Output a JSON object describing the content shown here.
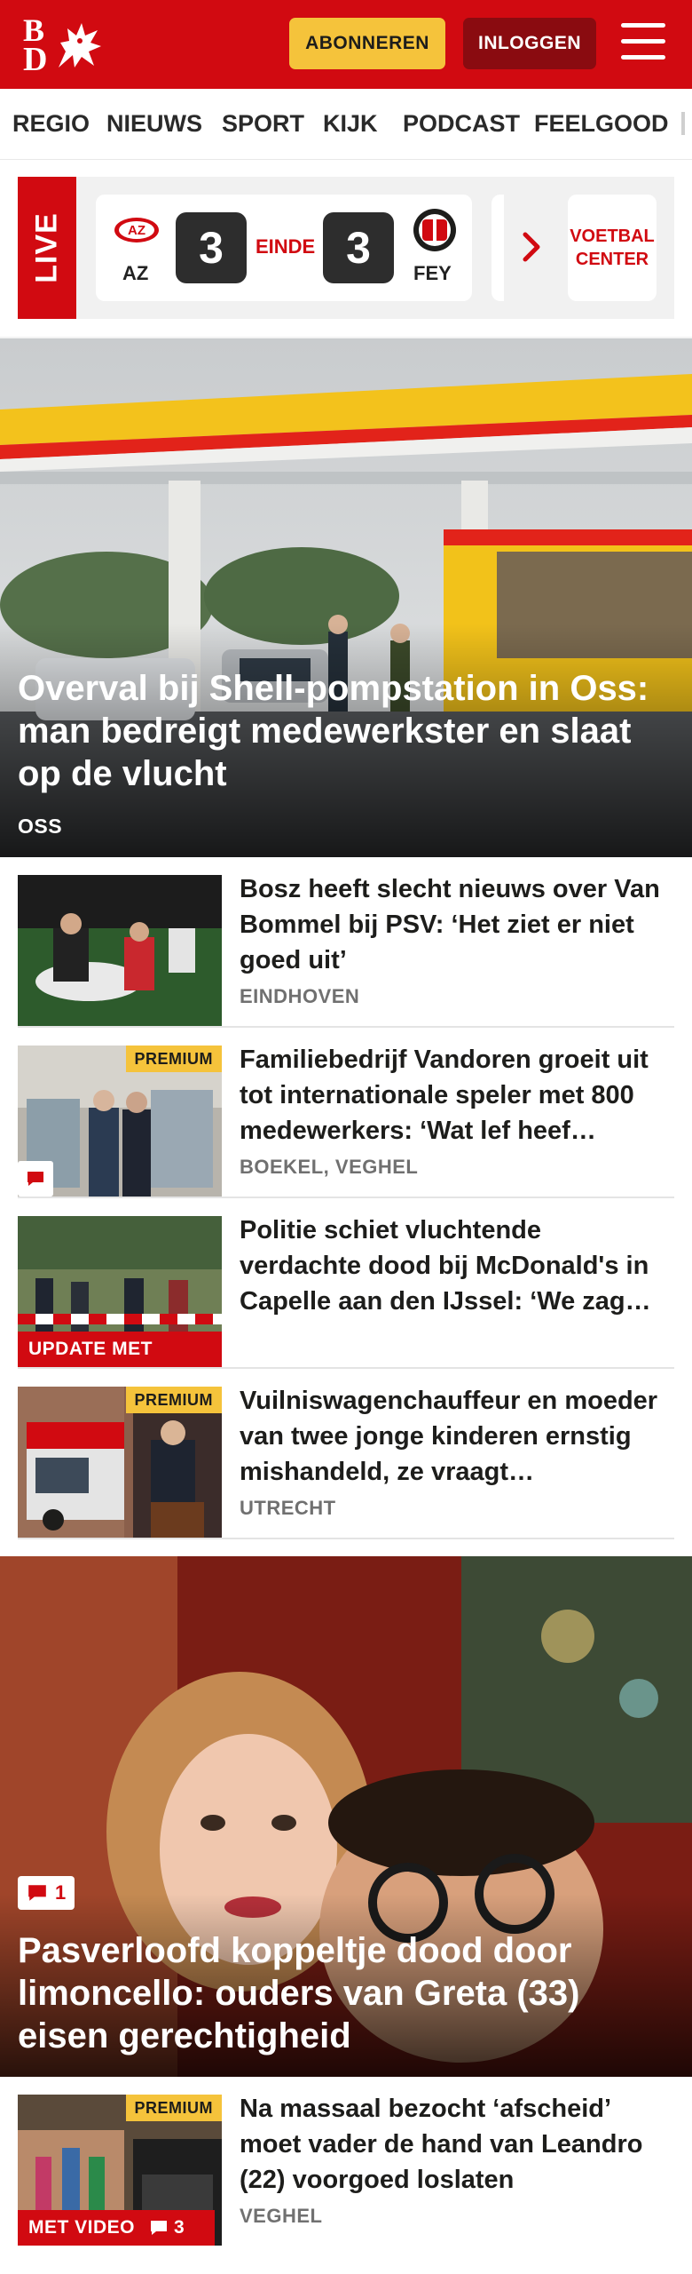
{
  "header": {
    "logo_text_b": "B",
    "logo_text_d": "D",
    "subscribe_label": "ABONNEREN",
    "login_label": "INLOGGEN",
    "menu_icon": "hamburger-icon",
    "brand_color": "#d10a11"
  },
  "nav": {
    "items": [
      {
        "label": "REGIO"
      },
      {
        "label": "NIEUWS"
      },
      {
        "label": "SPORT"
      },
      {
        "label": "KIJK"
      },
      {
        "label": "PODCAST"
      },
      {
        "label": "FEELGOOD"
      }
    ]
  },
  "live": {
    "badge": "LIVE",
    "match": {
      "home_team": "AZ",
      "away_team": "FEY",
      "home_score": "3",
      "away_score": "3",
      "status": "EINDE"
    },
    "voetbal_center_line1": "VOETBAL",
    "voetbal_center_line2": "CENTER"
  },
  "hero": {
    "title": "Overval bij Shell-pompstation in Oss: man bedreigt medewerkster en slaat op de vlucht",
    "place": "OSS"
  },
  "articles": [
    {
      "title": "Bosz heeft slecht nieuws over Van Bommel bij PSV: ‘Het ziet er niet goed uit’",
      "place": "EINDHOVEN",
      "premium": "",
      "label": "",
      "comments": ""
    },
    {
      "title": "Familiebedrijf Vandoren groeit uit tot internationale speler met 800 medewerkers: ‘Wat lef heef…",
      "place": "BOEKEL, VEGHEL",
      "premium": "PREMIUM",
      "label": "",
      "comments": ""
    },
    {
      "title": "Politie schiet vluchtende verdachte dood bij McDonald's in Capelle aan den IJssel: ‘We zag…",
      "place": "",
      "premium": "",
      "label": "UPDATE MET VIDEO",
      "comments": ""
    },
    {
      "title": "Vuilniswagenchauffeur en moeder van twee jonge kinderen ernstig mishandeld, ze vraagt…",
      "place": "UTRECHT",
      "premium": "PREMIUM",
      "label": "",
      "comments": ""
    }
  ],
  "hero2": {
    "title": "Pasverloofd koppeltje dood door limoncello: ouders van Greta (33) eisen gerechtigheid",
    "comments": "1"
  },
  "article5": {
    "title": "Na massaal bezocht ‘afscheid’ moet vader de hand van Leandro (22) voorgoed loslaten",
    "place": "VEGHEL",
    "premium": "PREMIUM",
    "label": "MET VIDEO",
    "comments": "3"
  }
}
